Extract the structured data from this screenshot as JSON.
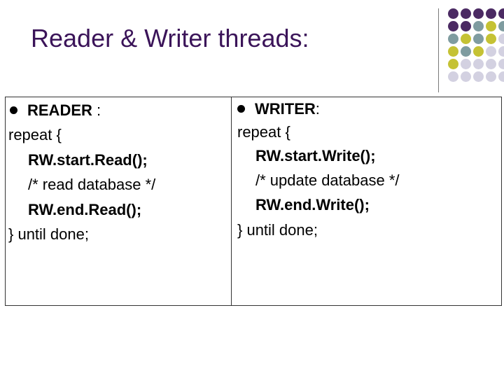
{
  "title": "Reader & Writer threads:",
  "colors": {
    "title": "#3b1459",
    "purple": "#4b2a63",
    "slate": "#7f9ca0",
    "olive": "#c5c234",
    "lavender": "#d3d1e1"
  },
  "reader": {
    "heading": "READER",
    "heading_suffix": " :",
    "lines": [
      "repeat {",
      "RW.start.Read();",
      "/* read database */",
      "RW.end.Read();",
      "} until done;"
    ]
  },
  "writer": {
    "heading": "WRITER",
    "heading_suffix": ":",
    "lines": [
      "repeat {",
      "RW.start.Write();",
      "/* update database */",
      "RW.end.Write();",
      "} until done;"
    ]
  }
}
